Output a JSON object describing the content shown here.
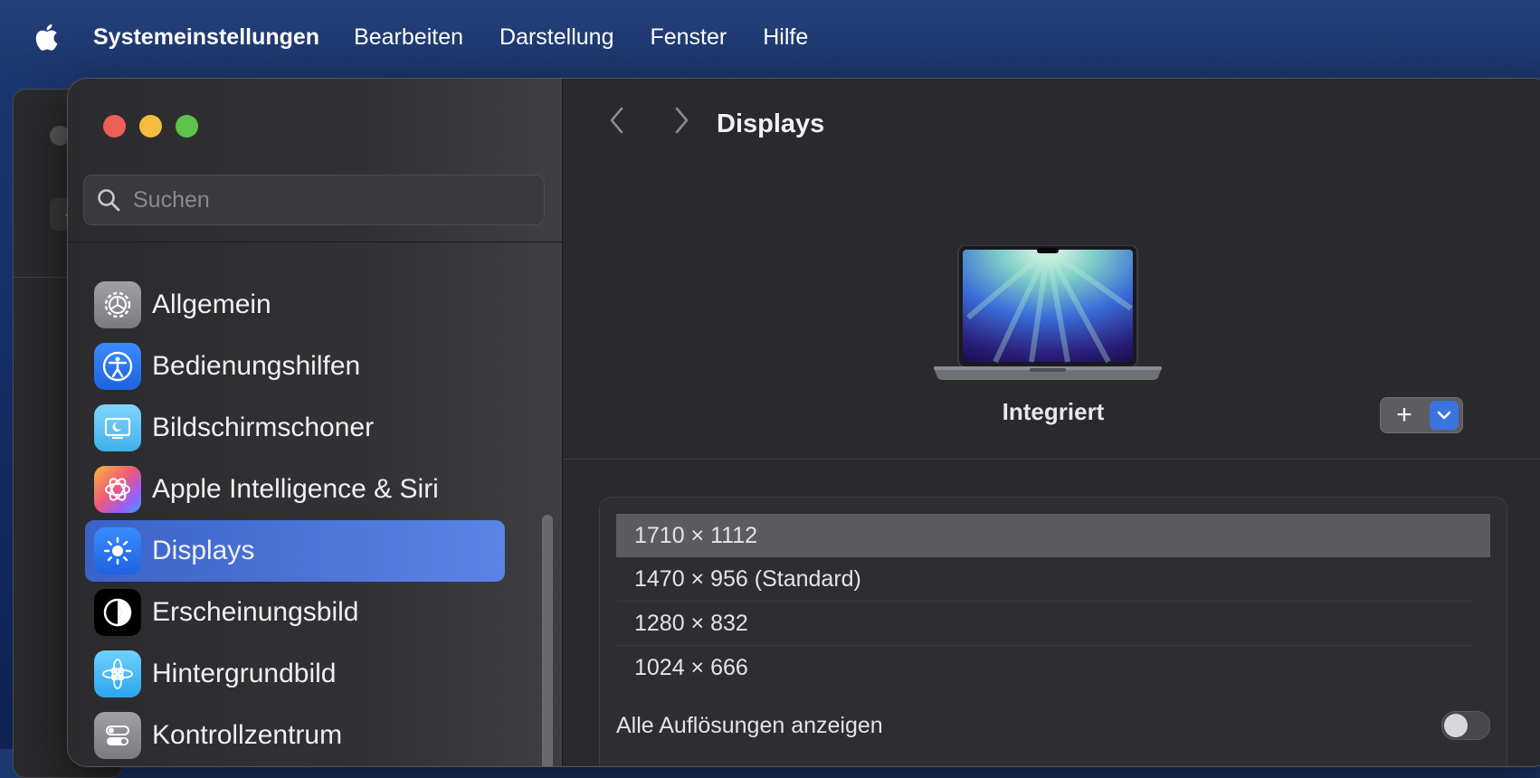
{
  "menubar": {
    "app_name": "Systemeinstellungen",
    "items": [
      "Bearbeiten",
      "Darstellung",
      "Fenster",
      "Hilfe"
    ]
  },
  "search": {
    "placeholder": "Suchen"
  },
  "sidebar": {
    "items": [
      {
        "label": "Allgemein",
        "icon": "gear-icon",
        "color": "#8e8e93"
      },
      {
        "label": "Bedienungshilfen",
        "icon": "accessibility-icon",
        "color": "#2f7cf6"
      },
      {
        "label": "Bildschirmschoner",
        "icon": "screensaver-icon",
        "color": "#5ec8f2"
      },
      {
        "label": "Apple Intelligence & Siri",
        "icon": "apple-intelligence-icon",
        "color": "#f08a5d"
      },
      {
        "label": "Displays",
        "icon": "sun-icon",
        "color": "#2f7cf6",
        "selected": true
      },
      {
        "label": "Erscheinungsbild",
        "icon": "appearance-icon",
        "color": "#000000"
      },
      {
        "label": "Hintergrundbild",
        "icon": "flower-icon",
        "color": "#49b7f0"
      },
      {
        "label": "Kontrollzentrum",
        "icon": "control-center-icon",
        "color": "#8e8e93"
      }
    ]
  },
  "content": {
    "title": "Displays",
    "display_name": "Integriert",
    "add_button": "+",
    "resolutions": [
      {
        "label": "1710 × 1112",
        "selected": true
      },
      {
        "label": "1470 × 956 (Standard)"
      },
      {
        "label": "1280 × 832"
      },
      {
        "label": "1024 × 666"
      }
    ],
    "show_all_label": "Alle Auflösungen anzeigen",
    "show_all_enabled": false
  },
  "colors": {
    "accent": "#3a63c8",
    "close": "#ed5f57",
    "minimize": "#f4bd3f",
    "zoom": "#5ec34a"
  }
}
